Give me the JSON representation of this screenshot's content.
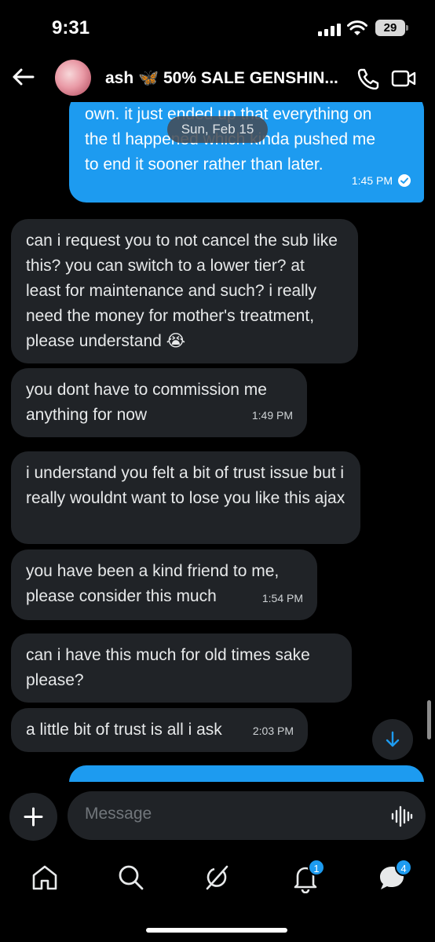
{
  "status_bar": {
    "time": "9:31",
    "battery": "29"
  },
  "header": {
    "contact_name": "ash 🦋 50% SALE GENSHIN..."
  },
  "chat": {
    "date_divider": "Sun, Feb 15",
    "outgoing_top": {
      "lines": [
        "own. it just ended up that everything on",
        "the tl happened which kinda pushed me",
        "to end it sooner rather than later."
      ],
      "time": "1:45 PM"
    },
    "incoming": [
      {
        "text": "can i request you to not cancel the sub like this? you can switch to a lower tier? at least for maintenance and such? i really need the money for mother's treatment, please understand 😭",
        "time": ""
      },
      {
        "text": "you dont have to commission me anything for now",
        "time": "1:49 PM"
      },
      {
        "text": "i understand you felt a bit of trust issue but i really wouldnt want to lose you like this ajax",
        "time": ""
      },
      {
        "text": "you have been a kind friend to me, please consider this much",
        "time": "1:54 PM"
      },
      {
        "text": "can i have this much for old times sake please?",
        "time": ""
      },
      {
        "text": "a little bit of trust is all i ask",
        "time": "2:03 PM"
      }
    ]
  },
  "composer": {
    "placeholder": "Message"
  },
  "nav": {
    "notifications_badge": "1",
    "messages_badge": "4"
  },
  "colors": {
    "accent": "#1d9bf0",
    "bubble_incoming": "#202327",
    "background": "#000000"
  }
}
